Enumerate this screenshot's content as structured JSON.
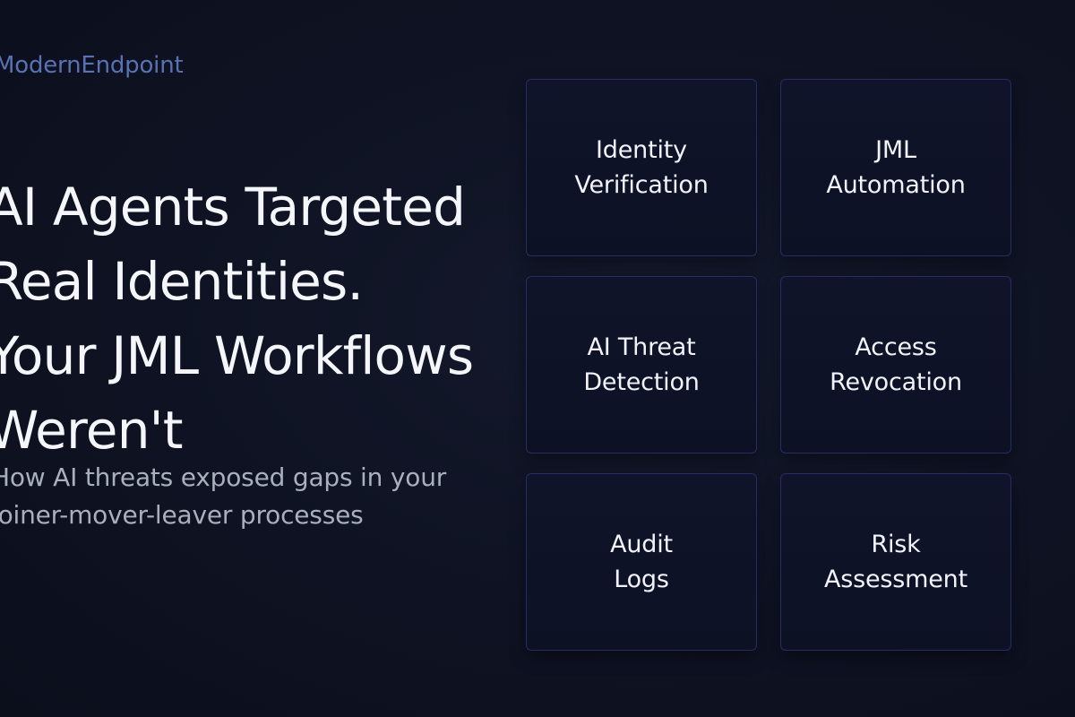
{
  "brand": {
    "name": "ModernEndpoint"
  },
  "hero": {
    "headline_lines": [
      "AI Agents Targeted",
      "Real Identities.",
      "Your JML Workflows",
      "Weren't"
    ],
    "subtitle_lines": [
      "How AI threats exposed gaps in your",
      "joiner-mover-leaver processes"
    ]
  },
  "tiles": [
    {
      "label": "Identity\nVerification"
    },
    {
      "label": "JML\nAutomation"
    },
    {
      "label": "AI Threat\nDetection"
    },
    {
      "label": "Access\nRevocation"
    },
    {
      "label": "Audit\nLogs"
    },
    {
      "label": "Risk\nAssessment"
    }
  ],
  "colors": {
    "background": "#0e1222",
    "brand": "#5a71b3",
    "tile_border": "#262d66",
    "headline": "#f4f6fa",
    "subtitle": "#a9afbd"
  }
}
